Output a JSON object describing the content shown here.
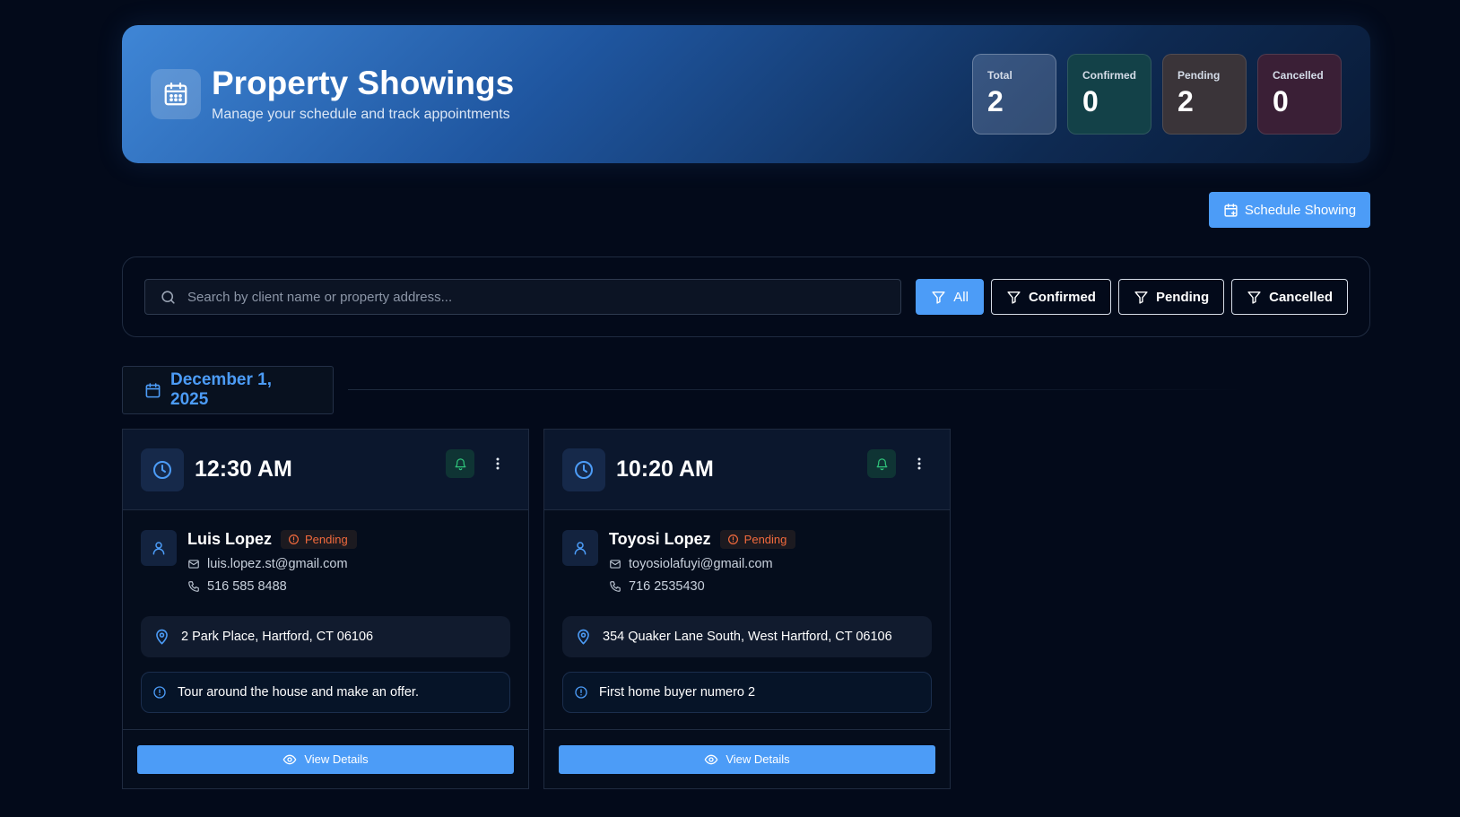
{
  "header": {
    "title": "Property Showings",
    "subtitle": "Manage your schedule and track appointments",
    "icon": "calendar-icon"
  },
  "stats": {
    "total": {
      "label": "Total",
      "value": "2"
    },
    "confirmed": {
      "label": "Confirmed",
      "value": "0"
    },
    "pending": {
      "label": "Pending",
      "value": "2"
    },
    "cancelled": {
      "label": "Cancelled",
      "value": "0"
    }
  },
  "toolbar": {
    "schedule_label": "Schedule Showing"
  },
  "filters": {
    "search_placeholder": "Search by client name or property address...",
    "all": "All",
    "confirmed": "Confirmed",
    "pending": "Pending",
    "cancelled": "Cancelled"
  },
  "date_group": {
    "date": "December 1, 2025"
  },
  "cards": [
    {
      "time": "12:30 AM",
      "client": "Luis Lopez",
      "status": "Pending",
      "email": "luis.lopez.st@gmail.com",
      "phone": "516 585 8488",
      "address": "2 Park Place, Hartford, CT 06106",
      "note": "Tour around the house and make an offer.",
      "view_label": "View Details"
    },
    {
      "time": "10:20 AM",
      "client": "Toyosi Lopez",
      "status": "Pending",
      "email": "toyosiolafuyi@gmail.com",
      "phone": "716 2535430",
      "address": "354 Quaker Lane South, West Hartford, CT 06106",
      "note": "First home buyer numero 2",
      "view_label": "View Details"
    }
  ],
  "colors": {
    "accent": "#4c9cf7",
    "pending": "#f26a3d",
    "background": "#030a1a"
  }
}
